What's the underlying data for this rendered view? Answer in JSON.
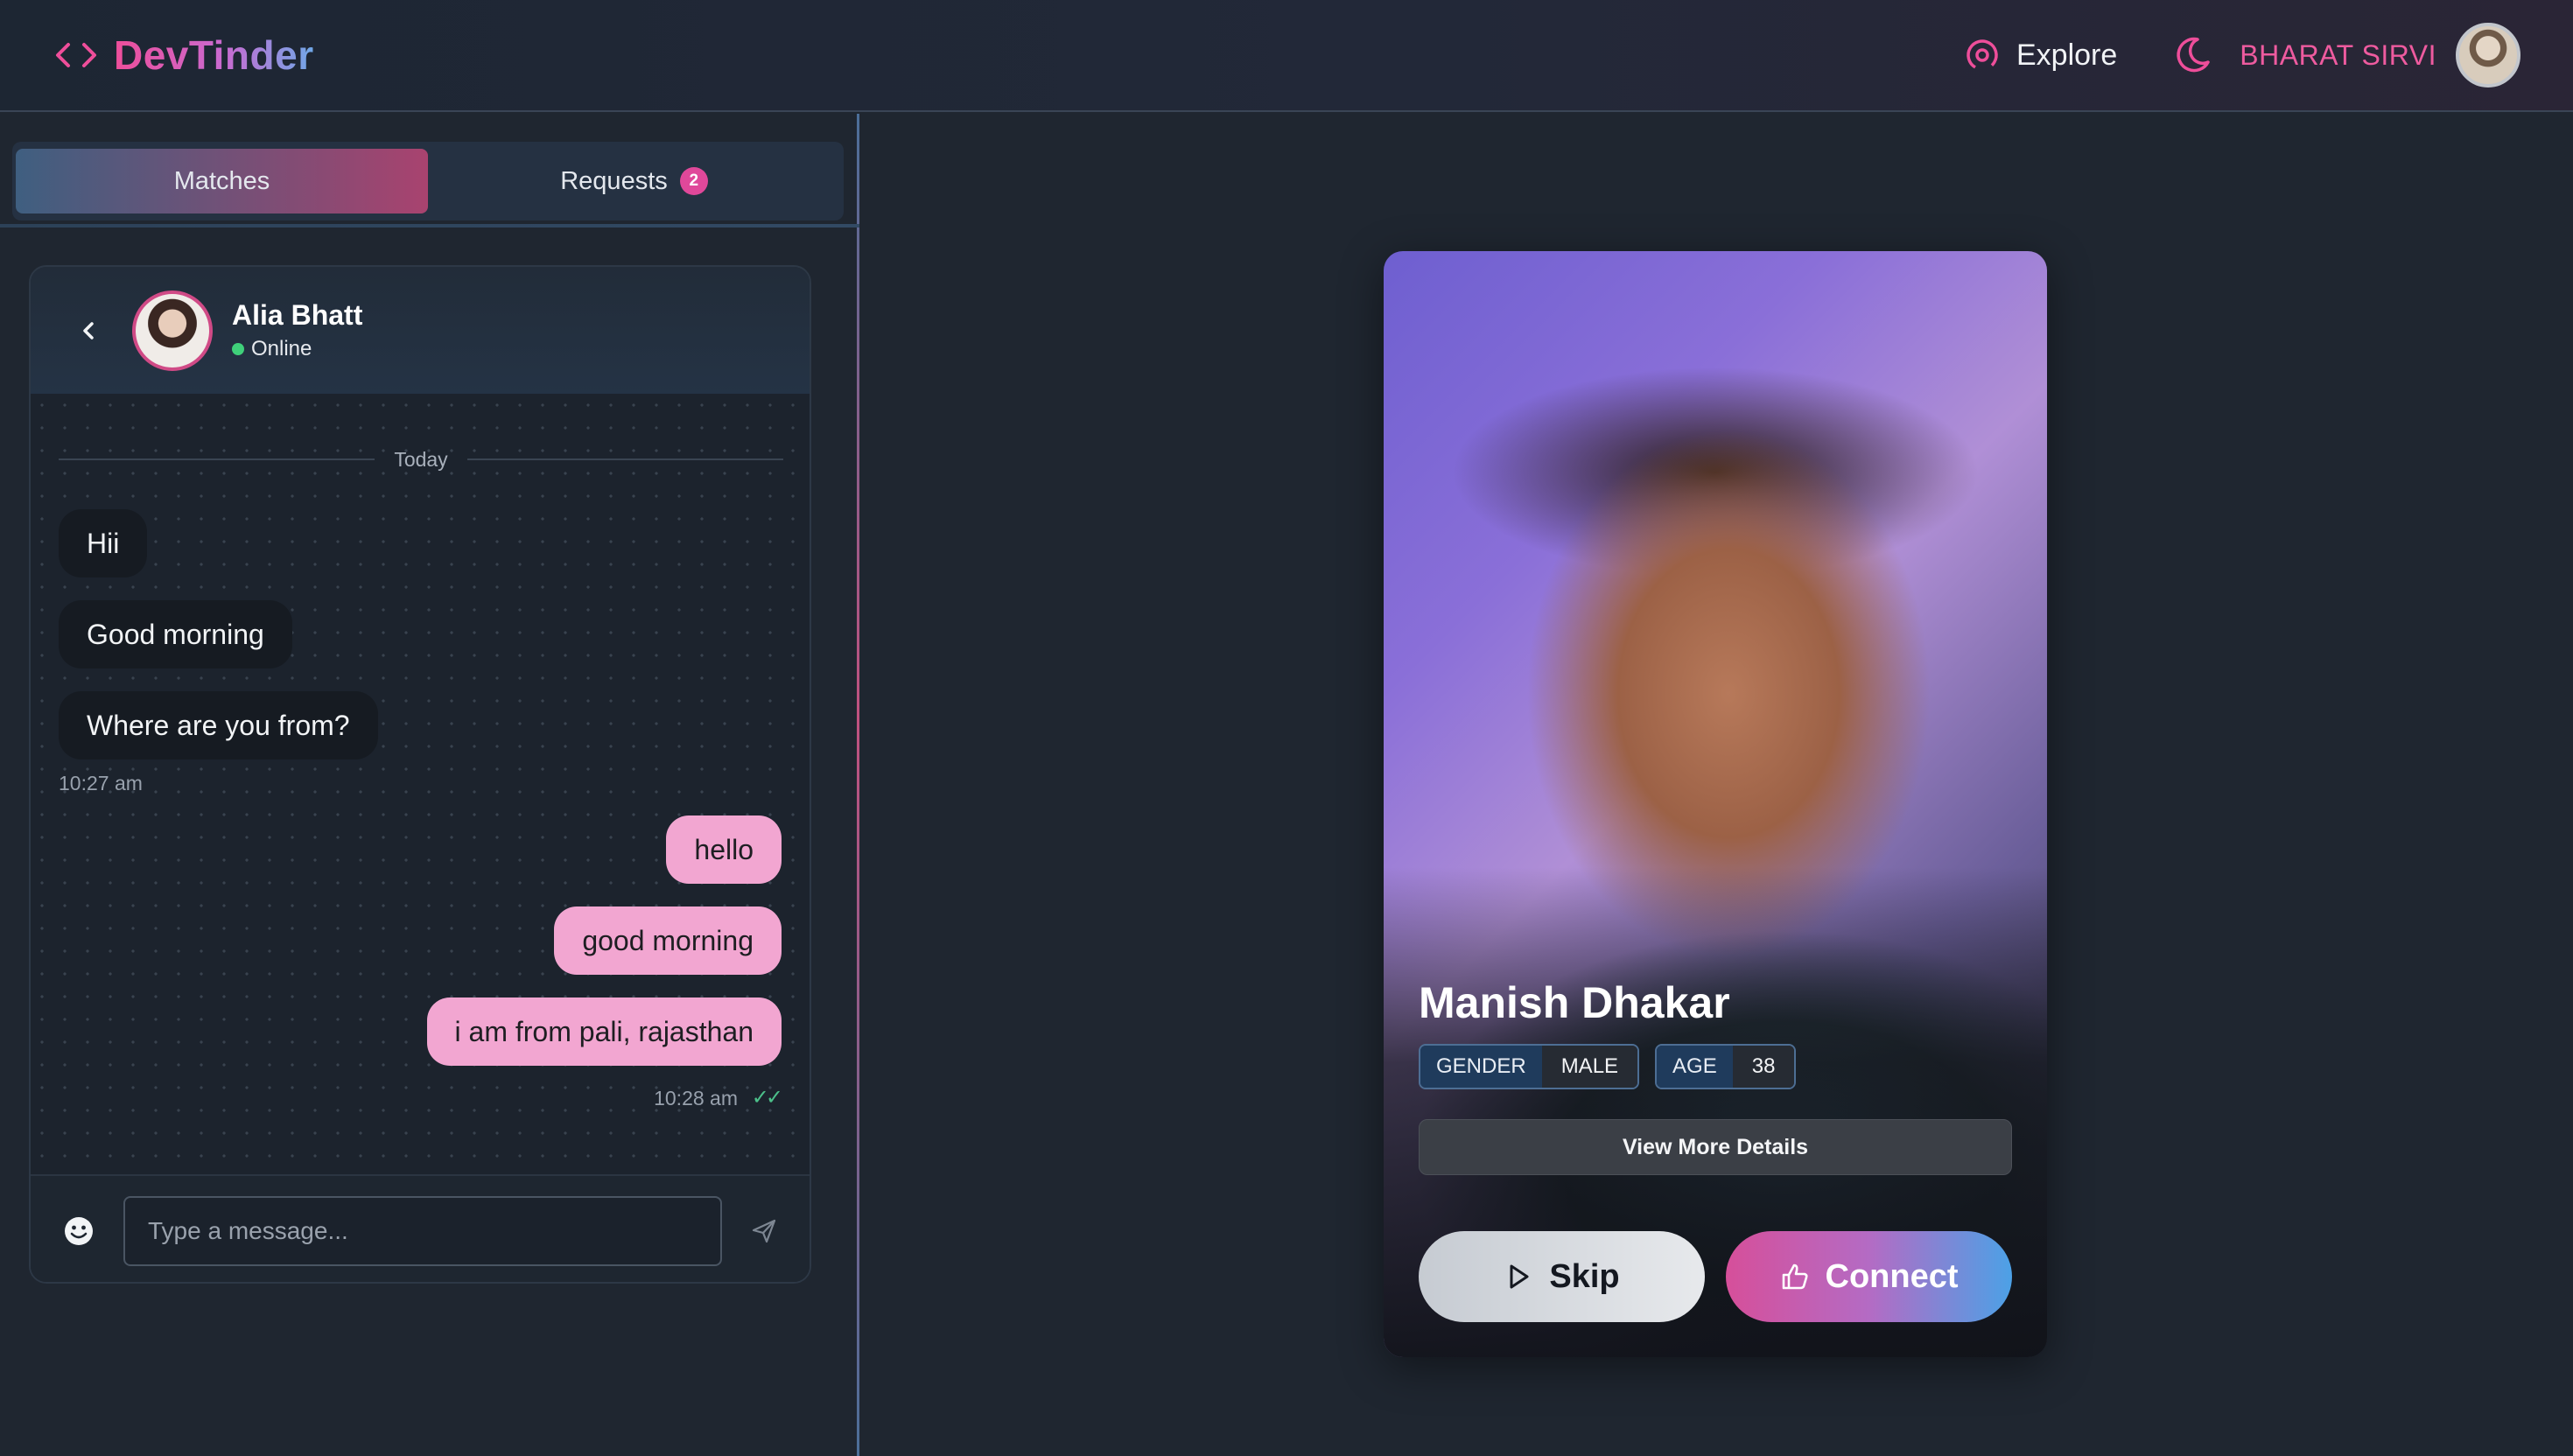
{
  "app": {
    "brand": "DevTinder",
    "colors": {
      "accent_pink": "#ee4e9a",
      "accent_blue": "#4ca1e6",
      "background": "#1f2630"
    }
  },
  "nav": {
    "explore_label": "Explore",
    "user_name": "BHARAT SIRVI",
    "icons": [
      "code-brackets-icon",
      "radar-icon",
      "moon-icon"
    ]
  },
  "tabs": {
    "matches_label": "Matches",
    "requests_label": "Requests",
    "requests_count": "2",
    "active": "Matches"
  },
  "chat": {
    "contact_name": "Alia Bhatt",
    "status": "Online",
    "date_label": "Today",
    "incoming": [
      {
        "text": "Hii"
      },
      {
        "text": "Good morning"
      },
      {
        "text": "Where are you from?"
      }
    ],
    "incoming_time": "10:27 am",
    "outgoing": [
      {
        "text": "hello"
      },
      {
        "text": "good morning"
      },
      {
        "text": "i am from pali, rajasthan"
      }
    ],
    "outgoing_time": "10:28 am",
    "read_receipt": "✓✓",
    "input_placeholder": "Type a message..."
  },
  "profile": {
    "name": "Manish Dhakar",
    "gender_key": "GENDER",
    "gender_value": "MALE",
    "age_key": "AGE",
    "age_value": "38",
    "details_label": "View More Details",
    "skip_label": "Skip",
    "connect_label": "Connect"
  }
}
